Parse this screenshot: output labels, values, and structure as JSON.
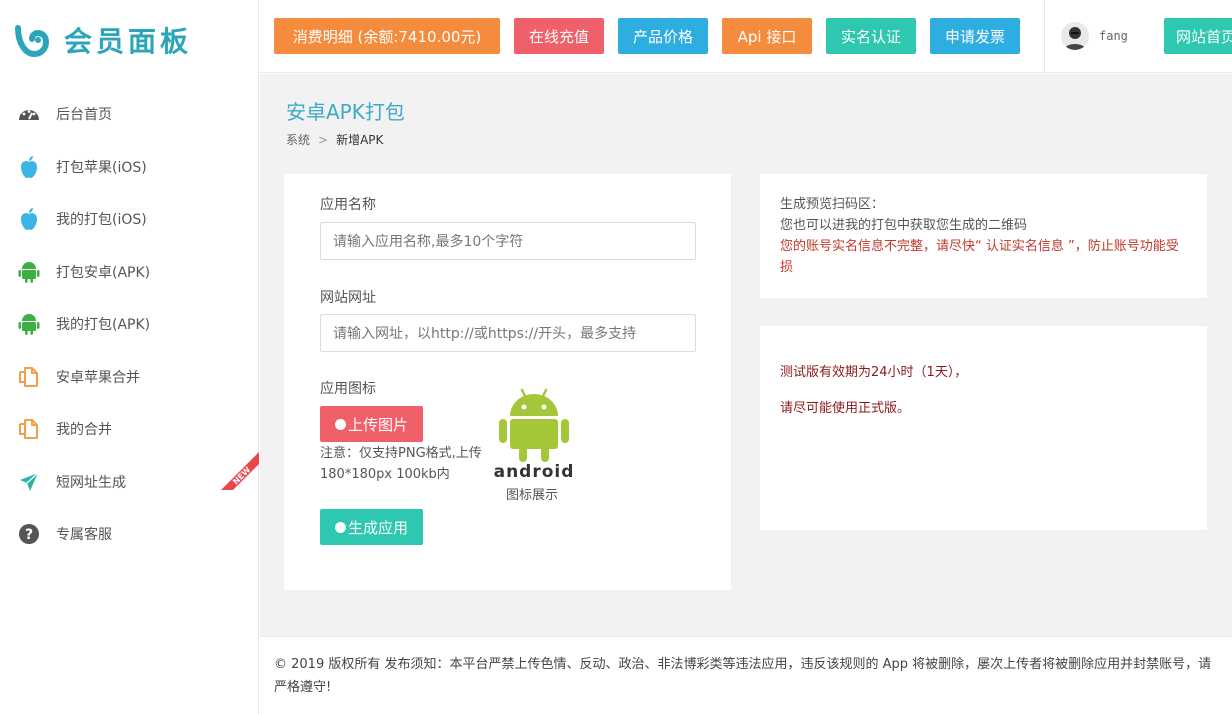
{
  "sidebar": {
    "logo_text": "会员面板",
    "items": [
      {
        "label": "后台首页",
        "icon": "dashboard-icon"
      },
      {
        "label": "打包苹果(iOS)",
        "icon": "apple-icon"
      },
      {
        "label": "我的打包(iOS)",
        "icon": "apple-icon"
      },
      {
        "label": "打包安卓(APK)",
        "icon": "android-icon"
      },
      {
        "label": "我的打包(APK)",
        "icon": "android-icon"
      },
      {
        "label": "安卓苹果合并",
        "icon": "copy-icon"
      },
      {
        "label": "我的合并",
        "icon": "copy-icon"
      },
      {
        "label": "短网址生成",
        "icon": "plane-icon",
        "badge": "NEW"
      },
      {
        "label": "专属客服",
        "icon": "help-icon"
      }
    ]
  },
  "topbar": {
    "buttons": [
      {
        "label": "消费明细 (余额:7410.00元)",
        "color": "#f58b3c"
      },
      {
        "label": "在线充值",
        "color": "#f0606a"
      },
      {
        "label": "产品价格",
        "color": "#2eaee0"
      },
      {
        "label": "Api 接口",
        "color": "#f58b3c"
      },
      {
        "label": "实名认证",
        "color": "#2ec7b0"
      },
      {
        "label": "申请发票",
        "color": "#2eaee0"
      },
      {
        "label": "网站首页",
        "color": "#2ec7b0"
      }
    ],
    "username": "fang"
  },
  "main": {
    "title": "安卓APK打包",
    "breadcrumb": {
      "root": "系统",
      "current": "新增APK"
    },
    "form": {
      "app_name_label": "应用名称",
      "app_name_placeholder": "请输入应用名称,最多10个字符",
      "url_label": "网站网址",
      "url_placeholder": "请输入网址，以http://或https://开头，最多支持",
      "icon_label": "应用图标",
      "upload_button": "上传图片",
      "upload_note": "注意：仅支持PNG格式,上传180*180px 100kb内",
      "android_wordmark": "android",
      "icon_caption": "图标展示",
      "generate_button": "生成应用"
    },
    "qr_panel": {
      "line1": "生成预览扫码区：",
      "line2": "您也可以进我的打包中获取您生成的二维码",
      "warning": "您的账号实名信息不完整，请尽快“ 认证实名信息 ”，防止账号功能受损"
    },
    "info_panel": {
      "line1": "测试版有效期为24小时（1天），",
      "line2": "请尽可能使用正式版。"
    }
  },
  "footer": {
    "text": "© 2019 版权所有 发布须知：本平台严禁上传色情、反动、政治、非法博彩类等违法应用，违反该规则的 App 将被删除，屡次上传者将被删除应用并封禁账号，请严格遵守!"
  },
  "colors": {
    "accent": "#2ba5b9",
    "upload_button": "#f0606a",
    "generate_button": "#2ec7b0",
    "android_green": "#a4c639"
  }
}
